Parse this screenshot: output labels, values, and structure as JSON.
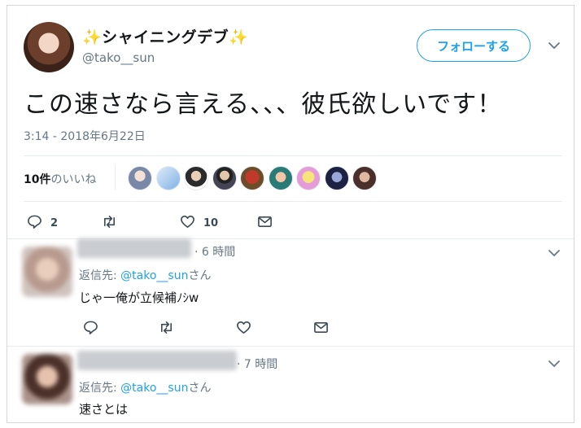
{
  "tweet": {
    "display_name": "✨シャイニングデブ✨",
    "username": "@tako__sun",
    "follow_label": "フォローする",
    "text": "この速さなら言える、、、彼氏欲しいです！",
    "timestamp": "3:14 - 2018年6月22日",
    "likes_count_bold": "10件",
    "likes_suffix": "のいいね",
    "reply_count": "2",
    "retweet_count": "",
    "like_count": "10"
  },
  "replies": [
    {
      "time": "· 6 時間",
      "reply_to_prefix": "返信先: ",
      "reply_to_handle": "@tako__sun",
      "reply_to_suffix": "さん",
      "text": "じゃ一俺が立候補ﾉｼw"
    },
    {
      "time": "· 7 時間",
      "reply_to_prefix": "返信先: ",
      "reply_to_handle": "@tako__sun",
      "reply_to_suffix": "さん",
      "text": "速さとは"
    }
  ],
  "colors": {
    "accent": "#1da1f2",
    "muted": "#657786",
    "text": "#14171a"
  },
  "icons": [
    "chevron-down-icon",
    "reply-icon",
    "retweet-icon",
    "heart-icon",
    "dm-icon"
  ]
}
